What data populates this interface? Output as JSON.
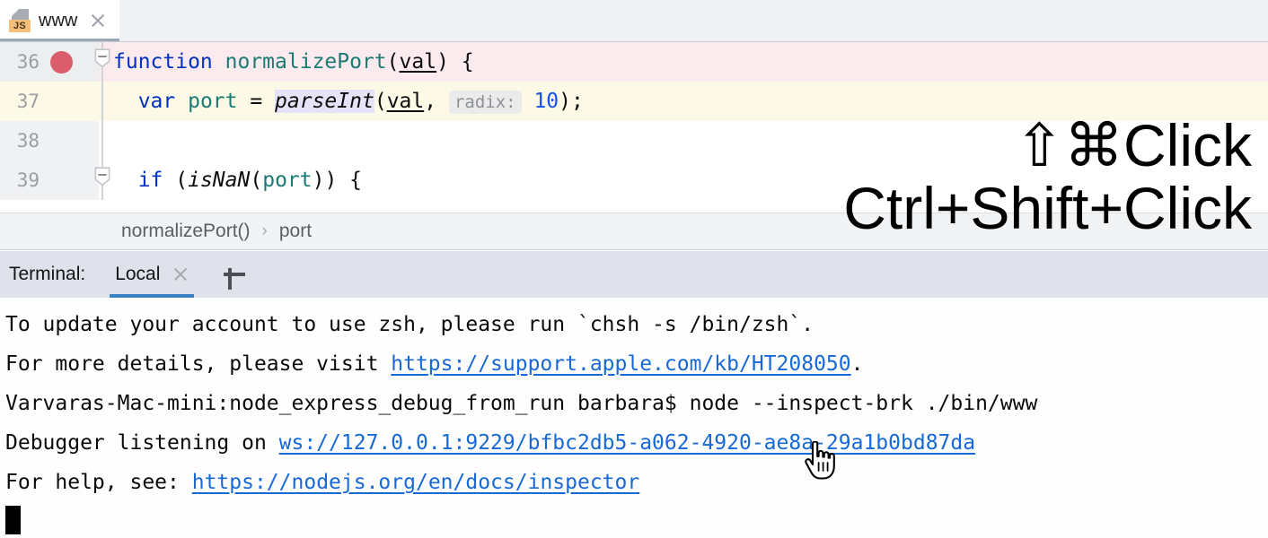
{
  "editor_tab": {
    "label": "www",
    "icon": "js-file-icon",
    "badge": "JS",
    "close_icon": "close-icon"
  },
  "code": {
    "lines": [
      {
        "number": "36",
        "has_breakpoint": true,
        "highlight": "breakpoint",
        "fold": true,
        "text": "function normalizePort(val) {"
      },
      {
        "number": "37",
        "has_breakpoint": false,
        "highlight": "caret",
        "fold": false,
        "text": "var port = parseInt(val,  radix: 10);",
        "inlay_hint": "radix:"
      },
      {
        "number": "38",
        "has_breakpoint": false,
        "highlight": "none",
        "fold": false,
        "text": ""
      },
      {
        "number": "39",
        "has_breakpoint": false,
        "highlight": "none",
        "fold": true,
        "text": "if (isNaN(port)) {"
      }
    ]
  },
  "breadcrumb": {
    "items": [
      "normalizePort()",
      "port"
    ],
    "separator": "›"
  },
  "tool_window": {
    "title": "Terminal:",
    "active_tab": "Local",
    "close_icon": "close-icon",
    "add_icon": "plus-icon",
    "accent_color": "#3b82c4"
  },
  "terminal": {
    "lines": [
      {
        "segments": [
          {
            "type": "text",
            "value": "To update your account to use zsh, please run `chsh -s /bin/zsh`."
          }
        ]
      },
      {
        "segments": [
          {
            "type": "text",
            "value": "For more details, please visit "
          },
          {
            "type": "link",
            "value": "https://support.apple.com/kb/HT208050"
          },
          {
            "type": "text",
            "value": "."
          }
        ]
      },
      {
        "segments": [
          {
            "type": "text",
            "value": "Varvaras-Mac-mini:node_express_debug_from_run barbara$ node --inspect-brk ./bin/www"
          }
        ]
      },
      {
        "segments": [
          {
            "type": "text",
            "value": "Debugger listening on "
          },
          {
            "type": "link",
            "value": "ws://127.0.0.1:9229/bfbc2db5-a062-4920-ae8a-29a1b0bd87da"
          }
        ]
      },
      {
        "segments": [
          {
            "type": "text",
            "value": "For help, see: "
          },
          {
            "type": "link",
            "value": "https://nodejs.org/en/docs/inspector"
          }
        ]
      }
    ],
    "prompt_cursor": "block-cursor",
    "link_color": "#1769d6"
  },
  "overlay_hint": {
    "line1_symbols": "⇧⌘",
    "line1_text": "Click",
    "line2": "Ctrl+Shift+Click"
  },
  "mouse": {
    "icon": "pointing-hand-cursor"
  }
}
